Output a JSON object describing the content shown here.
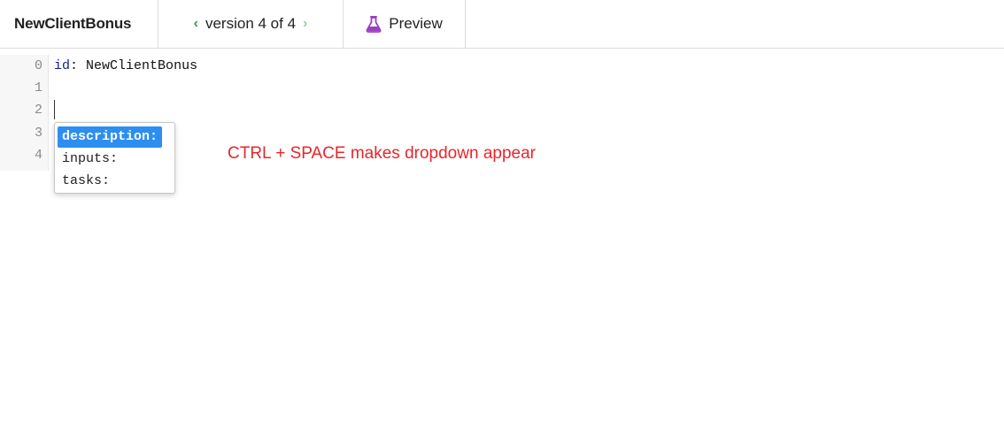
{
  "header": {
    "title": "NewClientBonus",
    "version_label": "version 4 of 4",
    "prev_icon": "chevron-left-icon",
    "next_icon": "chevron-right-icon",
    "preview_label": "Preview",
    "preview_icon": "flask-icon"
  },
  "editor": {
    "line_numbers": [
      "0",
      "1",
      "2",
      "3",
      "4"
    ],
    "line0_key": "id",
    "line0_colon": ":",
    "line0_value": "NewClientBonus"
  },
  "autocomplete": {
    "items": [
      "description:",
      "inputs:",
      "tasks:"
    ],
    "selected_index": 0
  },
  "annotation": {
    "text": "CTRL + SPACE makes dropdown appear",
    "color": "#e8262b"
  },
  "colors": {
    "accent_green": "#2aa24a",
    "flask_purple": "#9b3fc4",
    "selection_blue": "#2d8ef0"
  }
}
